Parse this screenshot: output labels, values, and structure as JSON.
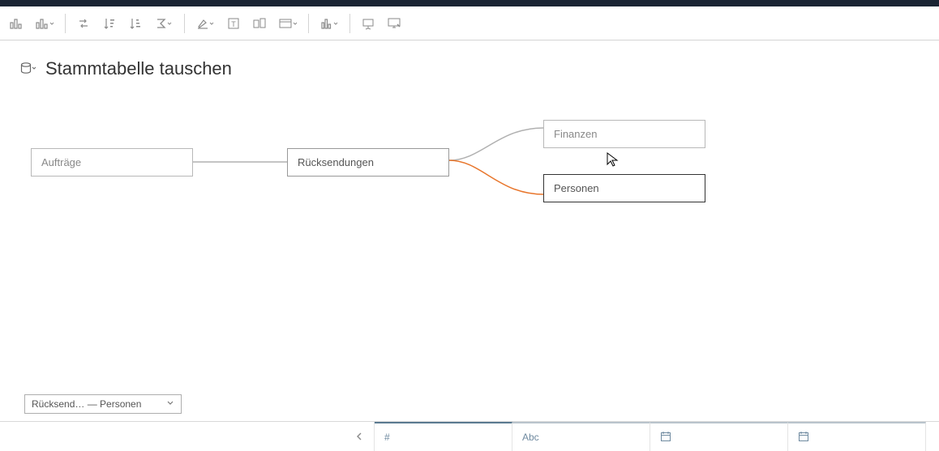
{
  "title": "Stammtabelle tauschen",
  "nodes": {
    "orders": "Aufträge",
    "returns": "Rücksendungen",
    "finance": "Finanzen",
    "people": "Personen"
  },
  "selector": {
    "text": "Rücksend…   —  Personen"
  },
  "grid": {
    "cols": [
      {
        "type": "#"
      },
      {
        "type": "Abc"
      },
      {
        "type": "date"
      },
      {
        "type": "date"
      }
    ]
  }
}
